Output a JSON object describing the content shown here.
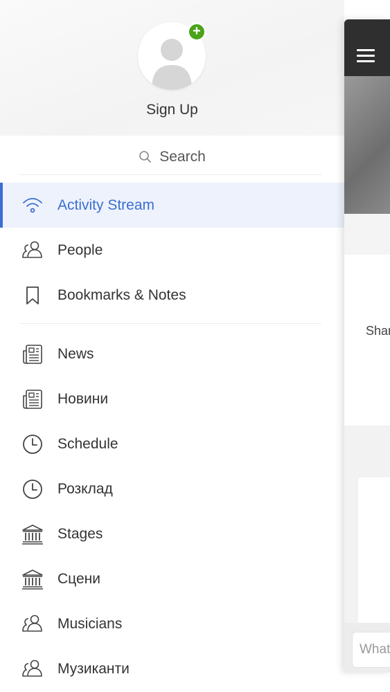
{
  "profile": {
    "signup_label": "Sign Up",
    "add_badge": "+"
  },
  "search": {
    "label": "Search"
  },
  "menu": {
    "primary": [
      {
        "label": "Activity Stream",
        "icon": "wifi-icon",
        "active": true
      },
      {
        "label": "People",
        "icon": "people-icon"
      },
      {
        "label": "Bookmarks & Notes",
        "icon": "bookmark-icon"
      }
    ],
    "secondary": [
      {
        "label": "News",
        "icon": "newspaper-icon"
      },
      {
        "label": "Новини",
        "icon": "newspaper-icon"
      },
      {
        "label": "Schedule",
        "icon": "clock-icon"
      },
      {
        "label": "Розклад",
        "icon": "clock-icon"
      },
      {
        "label": "Stages",
        "icon": "building-icon"
      },
      {
        "label": "Сцени",
        "icon": "building-icon"
      },
      {
        "label": "Musicians",
        "icon": "people-icon"
      },
      {
        "label": "Музиканти",
        "icon": "people-icon"
      }
    ]
  },
  "panel": {
    "share_text": "Shar",
    "compose_placeholder": "What"
  },
  "colors": {
    "accent": "#3a6fd0",
    "active_bg": "#eef2fc",
    "badge": "#4aa31a",
    "header": "#2f2f2f"
  }
}
